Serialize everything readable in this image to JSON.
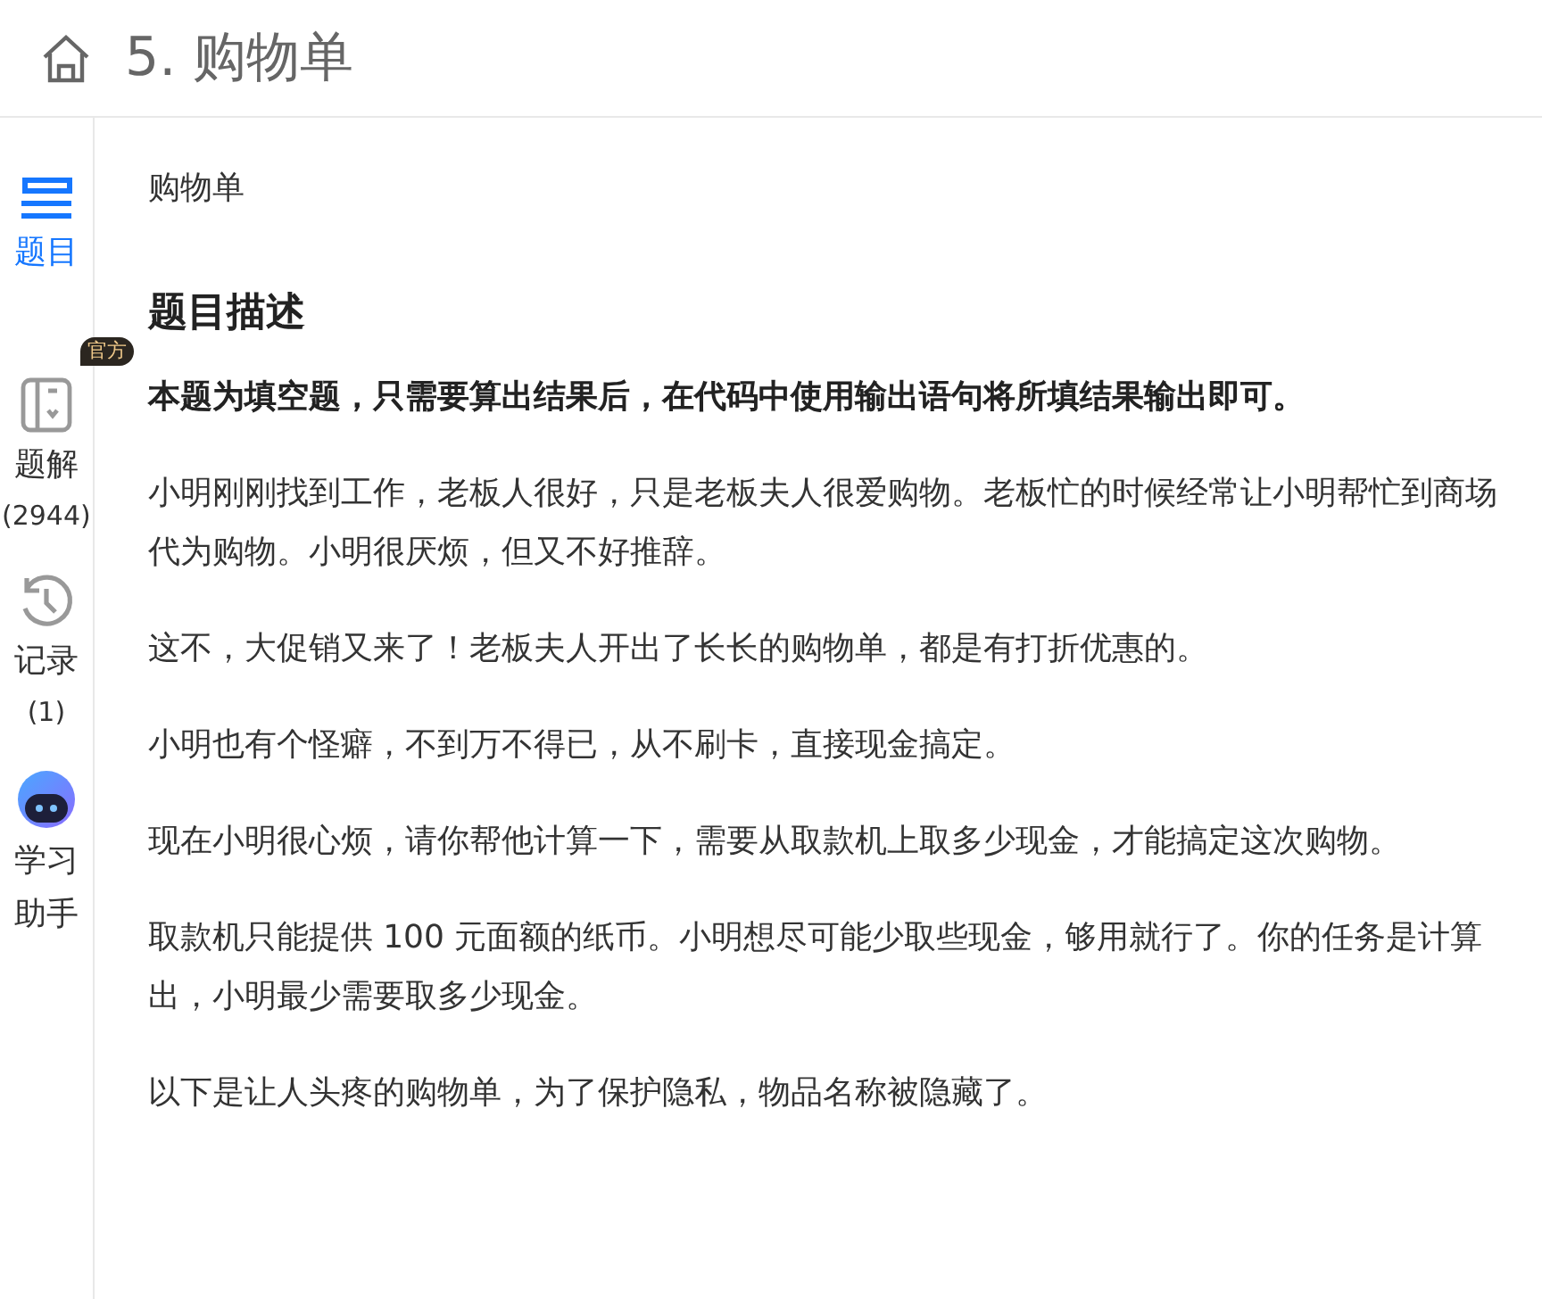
{
  "header": {
    "title": "5. 购物单"
  },
  "sidebar": {
    "items": [
      {
        "kind": "problem",
        "label": "题目",
        "selected": true
      },
      {
        "kind": "solution",
        "label": "题解",
        "badge": "官方",
        "count": "(2944)",
        "selected": false
      },
      {
        "kind": "history",
        "label": "记录",
        "count": "(1)",
        "selected": false
      },
      {
        "kind": "assistant",
        "label": "学习助手",
        "selected": false
      }
    ]
  },
  "content": {
    "breadcrumb": "购物单",
    "heading": "题目描述",
    "paragraphs": [
      {
        "kind": "notice",
        "text": "本题为填空题，只需要算出结果后，在代码中使用输出语句将所填结果输出即可。"
      },
      {
        "kind": "plain",
        "text": "小明刚刚找到工作，老板人很好，只是老板夫人很爱购物。老板忙的时候经常让小明帮忙到商场代为购物。小明很厌烦，但又不好推辞。"
      },
      {
        "kind": "plain",
        "text": "这不，大促销又来了！老板夫人开出了长长的购物单，都是有打折优惠的。"
      },
      {
        "kind": "plain",
        "text": "小明也有个怪癖，不到万不得已，从不刷卡，直接现金搞定。"
      },
      {
        "kind": "plain",
        "text": "现在小明很心烦，请你帮他计算一下，需要从取款机上取多少现金，才能搞定这次购物。"
      },
      {
        "kind": "plain",
        "text": "取款机只能提供 100 元面额的纸币。小明想尽可能少取些现金，够用就行了。你的任务是计算出，小明最少需要取多少现金。"
      },
      {
        "kind": "plain",
        "text": "以下是让人头疼的购物单，为了保护隐私，物品名称被隐藏了。"
      }
    ]
  }
}
